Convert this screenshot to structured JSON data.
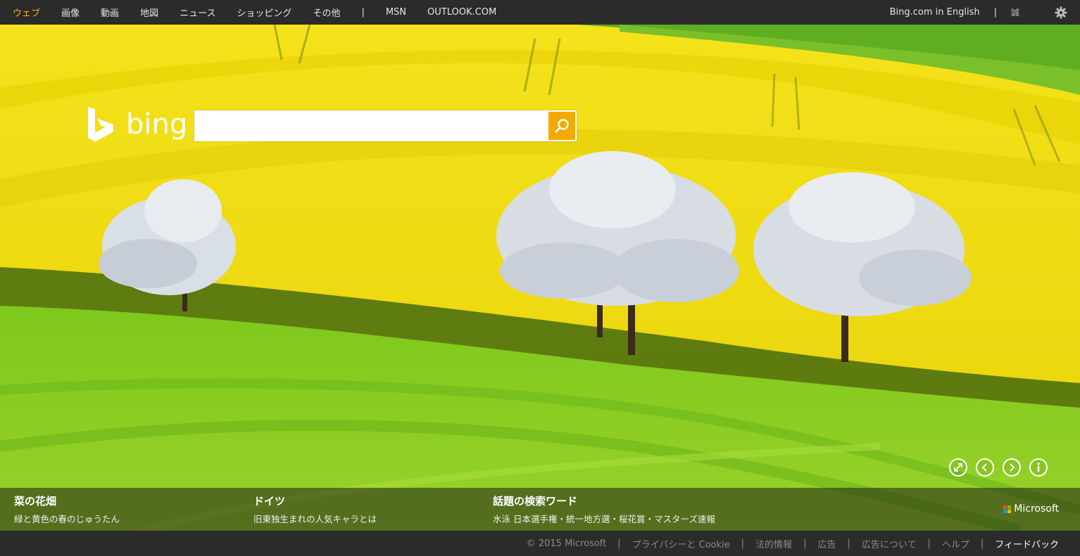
{
  "nav": {
    "items": [
      {
        "label": "ウェブ",
        "active": true
      },
      {
        "label": "画像"
      },
      {
        "label": "動画"
      },
      {
        "label": "地図"
      },
      {
        "label": "ニュース"
      },
      {
        "label": "ショッピング"
      },
      {
        "label": "その他"
      }
    ],
    "separator": "|",
    "msn": "MSN",
    "outlook": "OUTLOOK.COM",
    "english": "Bing.com in English",
    "user": "誠",
    "settings_icon": "gear-icon"
  },
  "logo": {
    "text": "bing"
  },
  "search": {
    "value": "",
    "placeholder": "",
    "button_icon": "search-icon"
  },
  "controls": [
    "expand-icon",
    "prev-icon",
    "next-icon",
    "info-icon"
  ],
  "cards": [
    {
      "title": "菜の花畑",
      "subtitle": "緑と黄色の春のじゅうたん"
    },
    {
      "title": "ドイツ",
      "subtitle": "旧東独生まれの人気キャラとは"
    },
    {
      "title": "話題の検索ワード",
      "subtitle": "水泳 日本選手権・統一地方選・桜花賞・マスターズ速報"
    }
  ],
  "brand": {
    "name": "Microsoft"
  },
  "footer": {
    "items": [
      "© 2015 Microsoft",
      "プライバシーと Cookie",
      "法的情報",
      "広告",
      "広告について",
      "ヘルプ",
      "フィードバック"
    ],
    "separator": "|"
  },
  "colors": {
    "accent": "#f5b700",
    "search_button": "#f2a900",
    "topbar": "#2b2b2b"
  }
}
